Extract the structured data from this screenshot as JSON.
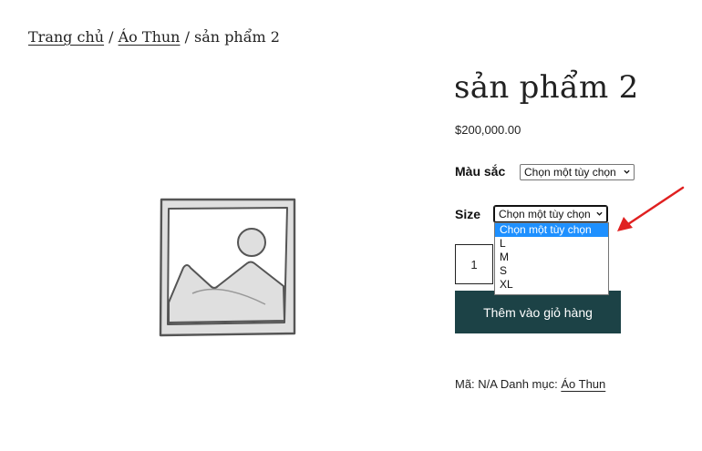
{
  "breadcrumb": {
    "home": "Trang chủ",
    "sep1": " / ",
    "category": "Áo Thun",
    "sep2": " / ",
    "current": "sản phẩm 2"
  },
  "product": {
    "title": "sản phẩm 2",
    "price": "$200,000.00"
  },
  "variations": {
    "color_label": "Màu sắc",
    "color_value": "Chọn một tùy chọn",
    "size_label": "Size",
    "size_value": "Chọn một tùy chọn",
    "size_options": [
      "Chọn một tùy chọn",
      "L",
      "M",
      "S",
      "XL"
    ]
  },
  "cart": {
    "quantity": "1",
    "add_label": "Thêm vào giỏ hàng"
  },
  "meta": {
    "sku_label": "Mã: N/A",
    "category_label": " Danh mục: ",
    "category_value": "Áo Thun"
  },
  "colors": {
    "button_bg": "#1c4246",
    "highlight": "#1e90ff",
    "annotation_arrow": "#e02020"
  },
  "icons": {
    "placeholder": "image-placeholder-icon",
    "chevron": "chevron-down-icon",
    "annotation": "arrow-annotation-icon"
  }
}
